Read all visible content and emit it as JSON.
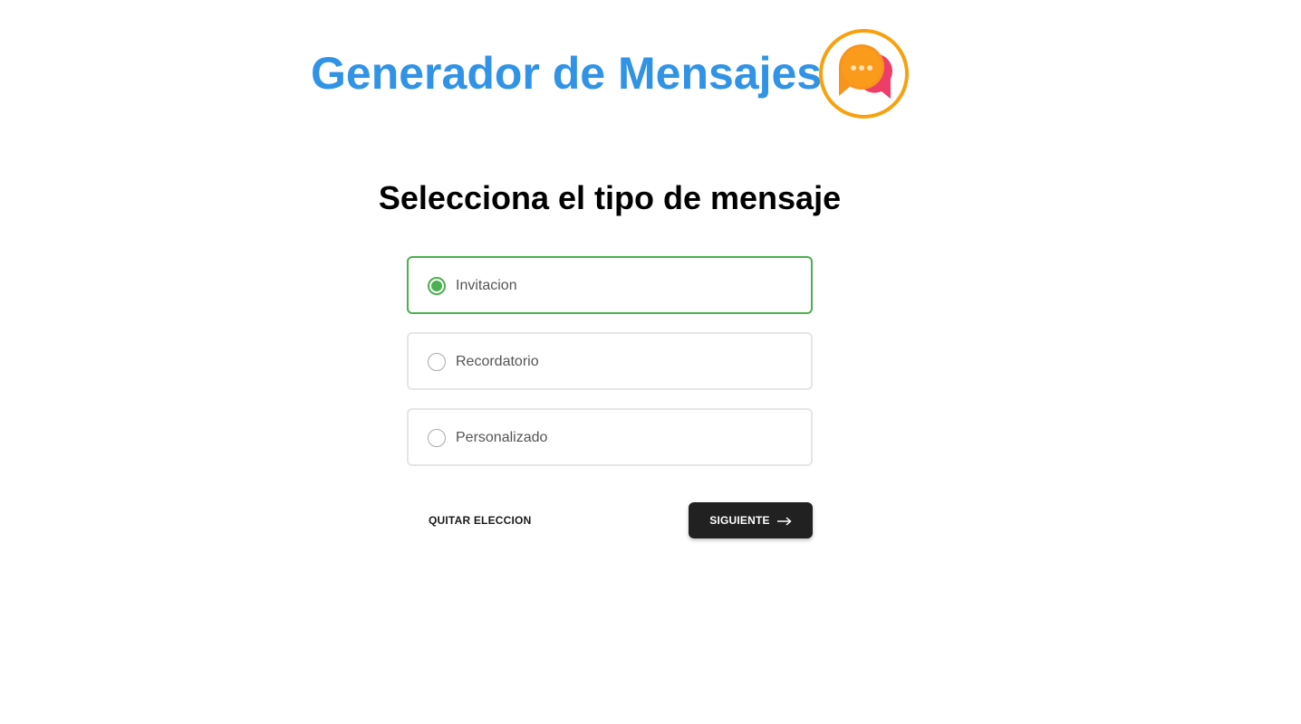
{
  "header": {
    "title": "Generador de Mensajes",
    "logo_icon": "chat-bubbles-icon",
    "title_color": "#3093e6",
    "logo_ring_color": "#f7a10e"
  },
  "main": {
    "heading": "Selecciona el tipo de mensaje",
    "options": [
      {
        "label": "Invitacion",
        "selected": true
      },
      {
        "label": "Recordatorio",
        "selected": false
      },
      {
        "label": "Personalizado",
        "selected": false
      }
    ],
    "selected_color": "#4caf50"
  },
  "actions": {
    "clear_label": "QUITAR ELECCION",
    "next_label": "SIGUIENTE",
    "next_icon": "arrow-right-icon",
    "next_bg_color": "#212121"
  }
}
